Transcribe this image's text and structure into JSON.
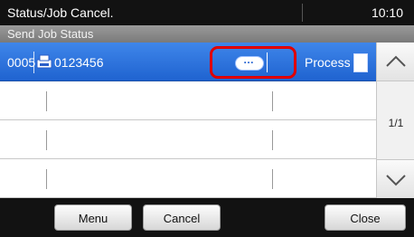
{
  "header": {
    "title": "Status/Job Cancel.",
    "time": "10:10"
  },
  "subheader": {
    "label": "Send Job Status"
  },
  "jobs": [
    {
      "job_no": "0005",
      "destination": "0123456",
      "status": "Process",
      "detail_button": "…"
    }
  ],
  "pagination": {
    "page": "1/1"
  },
  "footer": {
    "menu_label": "Menu",
    "cancel_label": "Cancel",
    "close_label": "Close"
  },
  "icons": {
    "scroll_up": "chevron-up-icon",
    "scroll_down": "chevron-down-icon",
    "send": "fax-send-icon",
    "document": "document-icon"
  },
  "colors": {
    "selection": "#1f63d0",
    "highlight": "#e00000"
  }
}
